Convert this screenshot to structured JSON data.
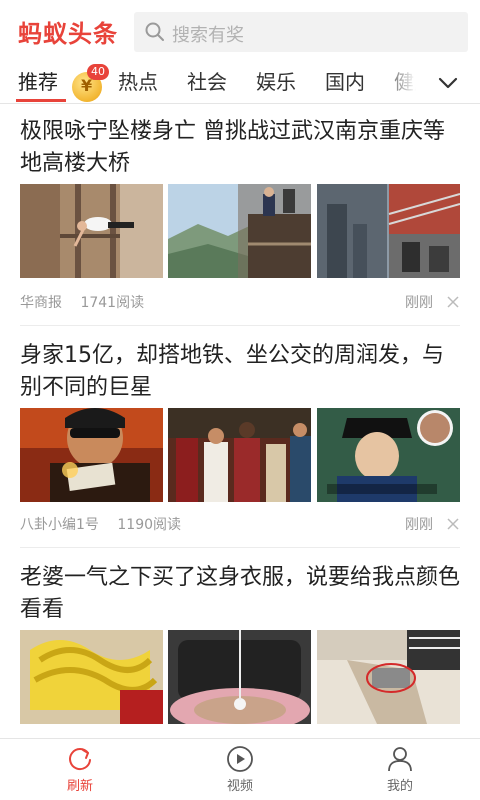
{
  "header": {
    "logo": "蚂蚁头条",
    "search_placeholder": "搜索有奖"
  },
  "tabs": {
    "items": [
      "推荐",
      "热点",
      "社会",
      "娱乐",
      "国内",
      "健康"
    ],
    "active": "推荐",
    "coin_glyph": "¥",
    "coin_badge": "40"
  },
  "articles": [
    {
      "title": "极限咏宁坠楼身亡 曾挑战过武汉南京重庆等地高楼大桥",
      "source": "华商报",
      "reads": "1741阅读",
      "time": "刚刚"
    },
    {
      "title": "身家15亿，却搭地铁、坐公交的周润发，与别不同的巨星",
      "source": "八卦小编1号",
      "reads": "1190阅读",
      "time": "刚刚"
    },
    {
      "title": "老婆一气之下买了这身衣服，说要给我点颜色看看",
      "source": "",
      "reads": "",
      "time": ""
    }
  ],
  "bottom_nav": {
    "items": [
      {
        "label": "刷新",
        "icon": "refresh-icon",
        "active": true
      },
      {
        "label": "视频",
        "icon": "play-icon",
        "active": false
      },
      {
        "label": "我的",
        "icon": "user-icon",
        "active": false
      }
    ]
  },
  "colors": {
    "accent": "#e8433a",
    "muted_text": "#999999"
  }
}
